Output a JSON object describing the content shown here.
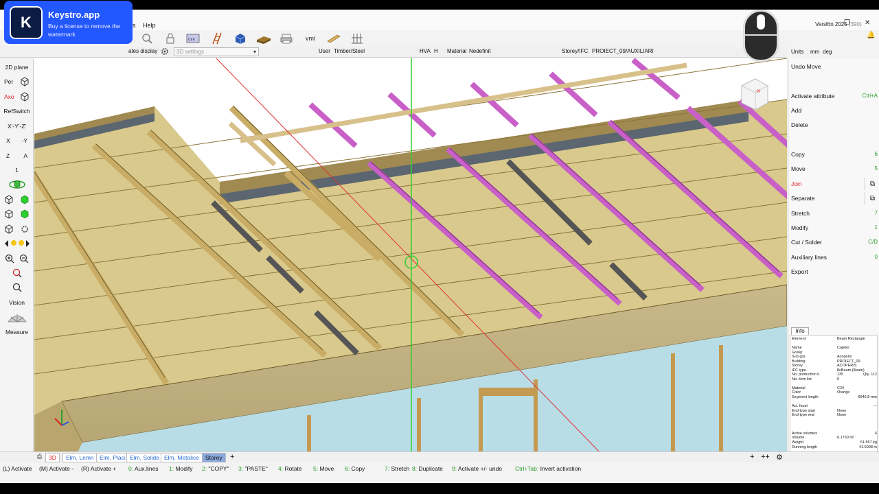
{
  "overlay": {
    "logo_letter": "K",
    "title": "Keystro.app",
    "subtitle": "Buy a license to remove the watermark"
  },
  "menu": {
    "partial": "s",
    "help": "Help"
  },
  "window": {
    "version": "Version 2025",
    "build": "(390)",
    "minimize": "–",
    "restore": "❐",
    "close": "✕"
  },
  "toolbar": {
    "vml": "vml",
    "icons": [
      "search-icon",
      "lock-icon",
      "csv-import-icon",
      "ladder-icon",
      "box-icon",
      "wood-icon",
      "print-icon",
      "vml-icon",
      "beam-icon",
      "grid-icon"
    ]
  },
  "optbar": {
    "display": "ates display",
    "settings_placeholder": "3D settings",
    "user_label": "User",
    "user_value": "Timber/Steel",
    "hva_label": "HVA",
    "hva_value": "H",
    "material_label": "Material",
    "material_value": "Nedefinit",
    "storey_label": "Storey/IFC",
    "storey_value": "PROIECT_09/AUXILIARI"
  },
  "units": {
    "label": "Units",
    "length": "mm",
    "angle": "deg"
  },
  "left_tools": {
    "plane": "2D plane",
    "per": "Per",
    "axo": "Axo",
    "refswitch": "RefSwitch",
    "axes": "X'-Y'-Z'",
    "x": "X",
    "neg_y": "-Y",
    "z": "Z",
    "a": "A",
    "one": "1",
    "vision": "Vision",
    "measure": "Measure"
  },
  "viewcube": {
    "label": "-X"
  },
  "right_panel": {
    "undo": "Undo Move",
    "actions": [
      {
        "label": "Activate attribute",
        "key": "Ctrl+A"
      },
      {
        "label": "Add",
        "key": ""
      },
      {
        "label": "Delete",
        "key": ""
      },
      {
        "label": "Copy",
        "key": "6"
      },
      {
        "label": "Move",
        "key": "5"
      },
      {
        "label": "Join",
        "key": ""
      },
      {
        "label": "Separate",
        "key": ""
      },
      {
        "label": "Stretch",
        "key": "7"
      },
      {
        "label": "Modify",
        "key": "1"
      },
      {
        "label": "Cut / Solder",
        "key": "C/D"
      },
      {
        "label": "Auxiliary lines",
        "key": "0"
      },
      {
        "label": "Export",
        "key": ""
      }
    ]
  },
  "info": {
    "tab": "Info",
    "rows": [
      {
        "k": "Element",
        "v": "Beam Rectangle",
        "v2": ""
      },
      {
        "k": "Name",
        "v": "Caprior",
        "v2": ""
      },
      {
        "k": "Group",
        "v": "",
        "v2": ""
      },
      {
        "k": "Sub grp.",
        "v": "Acoperis",
        "v2": ""
      },
      {
        "k": "Building",
        "v": "PROIECT_09",
        "v2": ""
      },
      {
        "k": "Storey",
        "v": "ACOPERIS",
        "v2": ""
      },
      {
        "k": "IFC type",
        "v": "IfcBeam (Beam)",
        "v2": ""
      },
      {
        "k": "No. production li.",
        "v": "135",
        "v2": "Qty. 112"
      },
      {
        "k": "No. item list",
        "v": "0",
        "v2": ""
      },
      {
        "k": "Material",
        "v": "C24",
        "v2": ""
      },
      {
        "k": "Color",
        "v": "Orange",
        "v2": ""
      },
      {
        "k": "Segment length",
        "v": "",
        "v2": "6946.8 mm"
      },
      {
        "k": "Act. facet",
        "v": "",
        "v2": "---"
      },
      {
        "k": "End-type start",
        "v": "None",
        "v2": ""
      },
      {
        "k": "End-type end",
        "v": "None",
        "v2": ""
      },
      {
        "k": "Active volumes",
        "v": "",
        "v2": "6"
      },
      {
        "k": "Volume",
        "v": "0.1760 m³",
        "v2": ""
      },
      {
        "k": "Weight",
        "v": "",
        "v2": "61.557 kg"
      },
      {
        "k": "Running length",
        "v": "",
        "v2": "41.6908 m"
      }
    ]
  },
  "tabs": {
    "items": [
      {
        "label": "3D",
        "red": true,
        "active": false
      },
      {
        "label": "Elm. Lemn",
        "red": false,
        "active": false
      },
      {
        "label": "Elm. Placi",
        "red": false,
        "active": false
      },
      {
        "label": "Elm. Solide",
        "red": false,
        "active": false
      },
      {
        "label": "Elm. Metalice",
        "red": false,
        "active": false
      },
      {
        "label": "Storey",
        "red": false,
        "active": true
      }
    ],
    "add": "+"
  },
  "status": [
    {
      "key": "",
      "text": "(L) Activate"
    },
    {
      "key": "",
      "text": "(M) Activate -"
    },
    {
      "key": "",
      "text": "(R) Activate +"
    },
    {
      "key": "0:",
      "text": "Aux.lines"
    },
    {
      "key": "1:",
      "text": "Modify"
    },
    {
      "key": "2:",
      "text": "\"COPY\""
    },
    {
      "key": "3:",
      "text": "\"PASTE\""
    },
    {
      "key": "4:",
      "text": "Rotate"
    },
    {
      "key": "5:",
      "text": "Move"
    },
    {
      "key": "6:",
      "text": "Copy"
    },
    {
      "key": "7:",
      "text": "Stretch"
    },
    {
      "key": "8:",
      "text": "Duplicate"
    },
    {
      "key": "9:",
      "text": "Activate +/- undo"
    },
    {
      "key": "Ctrl+Tab:",
      "text": "Invert activation"
    }
  ]
}
